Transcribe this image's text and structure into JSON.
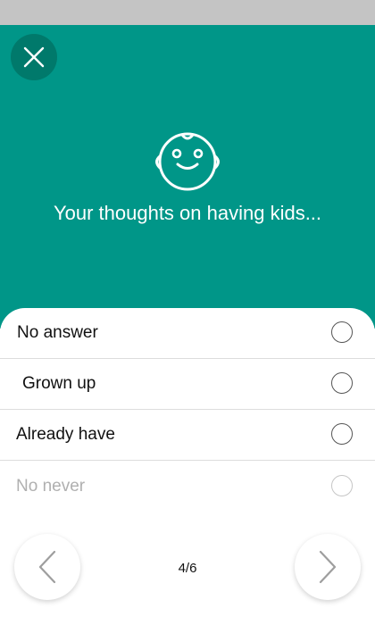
{
  "header": {
    "question": "Your thoughts on having kids...",
    "icon": "baby-face-icon",
    "background_color": "#009688",
    "close_button_color": "#00796b"
  },
  "options": [
    {
      "label": "No answer",
      "selected": false,
      "enabled": true
    },
    {
      "label": "Grown up",
      "selected": false,
      "enabled": true
    },
    {
      "label": "Already have",
      "selected": false,
      "enabled": true
    },
    {
      "label": "No never",
      "selected": false,
      "enabled": false
    }
  ],
  "pager": {
    "text": "4/6",
    "current": 4,
    "total": 6
  },
  "icons": {
    "close": "close-icon",
    "previous": "chevron-left-icon",
    "next": "chevron-right-icon"
  }
}
